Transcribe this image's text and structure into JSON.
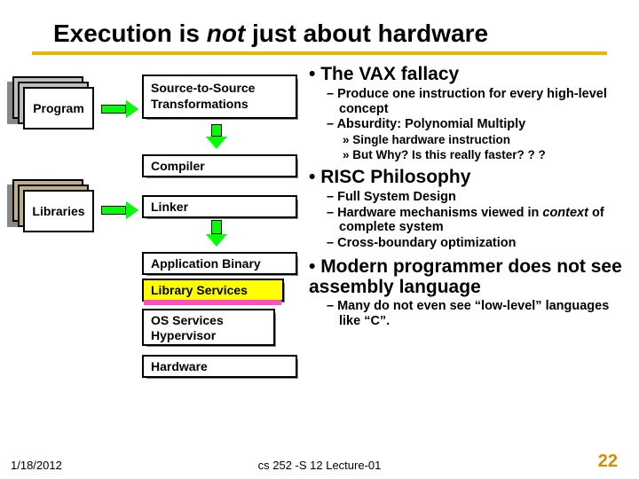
{
  "title": {
    "pre": "Execution is ",
    "not": "not",
    "post": " just about hardware"
  },
  "diagram": {
    "program": "Program",
    "libraries": "Libraries",
    "s2s_l1": "Source-to-Source",
    "s2s_l2": "Transformations",
    "compiler": "Compiler",
    "linker": "Linker",
    "appbin": "Application Binary",
    "libsvc": "Library Services",
    "ossvc_l1": "OS Services",
    "ossvc_l2": "Hypervisor",
    "hardware": "Hardware"
  },
  "bullets": {
    "vax": "The VAX fallacy",
    "vax_sub1": "Produce one instruction for every high-level concept",
    "vax_sub2": "Absurdity: Polynomial Multiply",
    "vax_sub2a": "Single hardware instruction",
    "vax_sub2b": "But Why?  Is this really faster? ? ?",
    "risc": "RISC Philosophy",
    "risc_sub1": "Full System Design",
    "risc_sub2_pre": "Hardware mechanisms viewed in ",
    "risc_sub2_ital": "context",
    "risc_sub2_post": " of complete system",
    "risc_sub3": "Cross-boundary optimization",
    "modern": "Modern programmer does not see assembly language",
    "modern_sub1": "Many do not even see “low-level” languages like “C”."
  },
  "footer": {
    "date": "1/18/2012",
    "course": "cs 252 -S 12 Lecture-01",
    "page": "22"
  }
}
